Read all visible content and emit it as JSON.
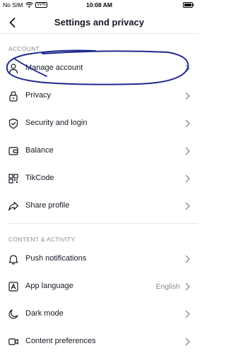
{
  "status_bar": {
    "carrier": "No SIM",
    "vpn": "VPN",
    "time": "10:08 AM"
  },
  "header": {
    "title": "Settings and privacy",
    "back_icon": "chevron-left-icon"
  },
  "sections": [
    {
      "header": "ACCOUNT",
      "items": [
        {
          "label": "Manage account",
          "icon": "person-icon"
        },
        {
          "label": "Privacy",
          "icon": "lock-icon"
        },
        {
          "label": "Security and login",
          "icon": "shield-icon"
        },
        {
          "label": "Balance",
          "icon": "wallet-icon"
        },
        {
          "label": "TikCode",
          "icon": "qr-code-icon"
        },
        {
          "label": "Share profile",
          "icon": "share-icon"
        }
      ]
    },
    {
      "header": "CONTENT & ACTIVITY",
      "items": [
        {
          "label": "Push notifications",
          "icon": "bell-icon"
        },
        {
          "label": "App language",
          "icon": "language-icon",
          "value": "English"
        },
        {
          "label": "Dark mode",
          "icon": "moon-icon"
        },
        {
          "label": "Content preferences",
          "icon": "video-icon"
        }
      ]
    }
  ],
  "colors": {
    "text": "#161823",
    "secondary_text": "#8a8b91",
    "divider": "#e6e6e7",
    "annotation": "#1f2a8f"
  }
}
